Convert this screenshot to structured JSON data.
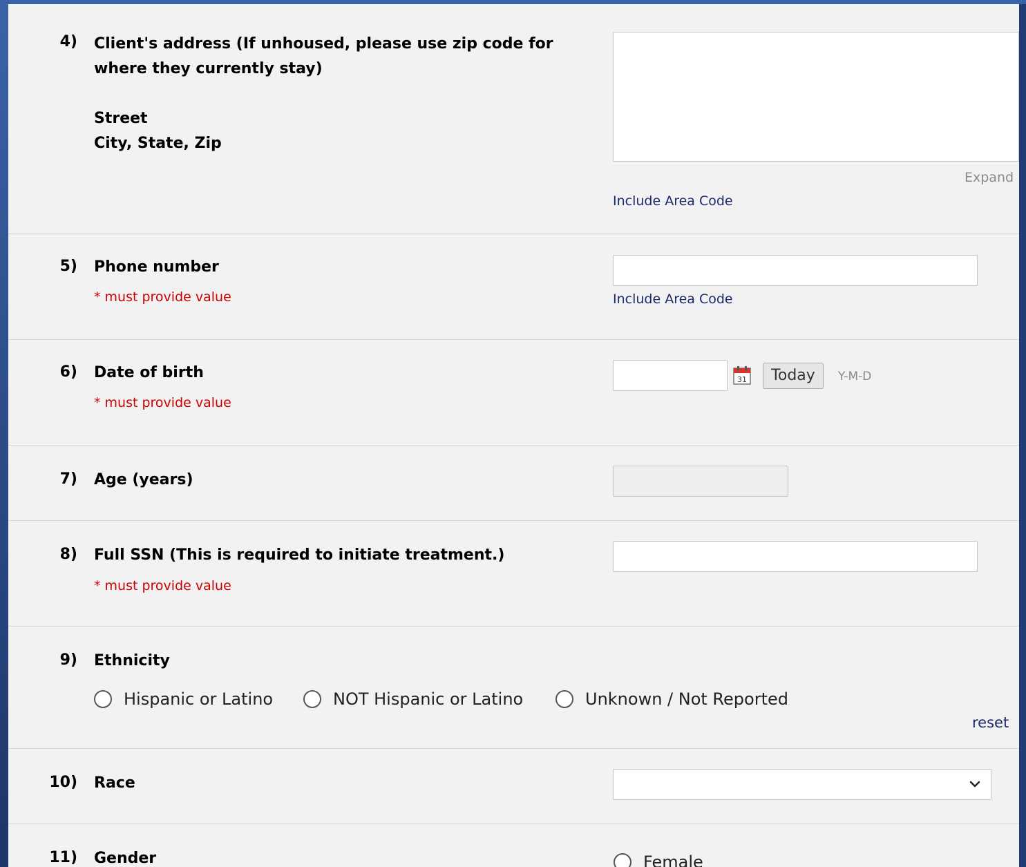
{
  "questions": {
    "q4": {
      "num": "4)",
      "line1": "Client's address (If unhoused, please use zip code for",
      "line2": "where they currently stay)",
      "line3": "Street",
      "line4": "City, State, Zip",
      "expand": "Expand",
      "hint": "Include Area Code"
    },
    "q5": {
      "num": "5)",
      "label": "Phone number",
      "required": "* must provide value",
      "hint": "Include Area Code"
    },
    "q6": {
      "num": "6)",
      "label": "Date of birth",
      "required": "* must provide value",
      "today": "Today",
      "format": "Y-M-D"
    },
    "q7": {
      "num": "7)",
      "label": "Age (years)"
    },
    "q8": {
      "num": "8)",
      "label": "Full SSN (This is required to initiate treatment.)",
      "required": "* must provide value"
    },
    "q9": {
      "num": "9)",
      "label": "Ethnicity",
      "options": [
        "Hispanic or Latino",
        "NOT Hispanic or Latino",
        "Unknown / Not Reported"
      ],
      "reset": "reset"
    },
    "q10": {
      "num": "10)",
      "label": "Race",
      "selected": ""
    },
    "q11": {
      "num": "11)",
      "label": "Gender",
      "options": [
        "Female"
      ]
    }
  },
  "icons": {
    "calendar": "calendar-icon",
    "dropdown": "chevron-down-icon"
  },
  "colors": {
    "required": "#cc0000",
    "hint": "#1c2a6b",
    "background": "#f2f2f2"
  }
}
